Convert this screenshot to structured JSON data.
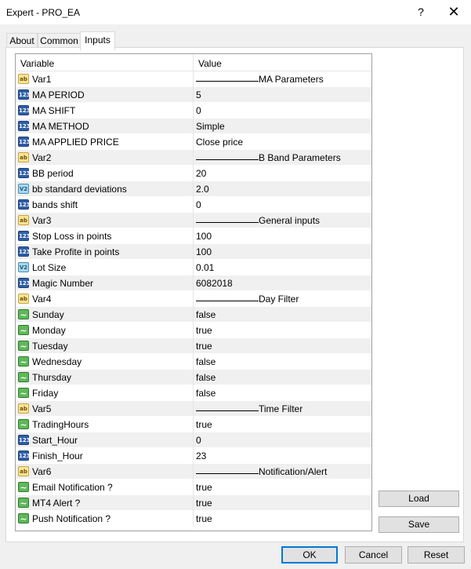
{
  "window": {
    "title": "Expert - PRO_EA",
    "help_glyph": "?",
    "close_glyph": "✕"
  },
  "tabs": [
    {
      "label": "About"
    },
    {
      "label": "Common"
    },
    {
      "label": "Inputs"
    }
  ],
  "table": {
    "headers": {
      "variable": "Variable",
      "value": "Value"
    },
    "rows": [
      {
        "type": "string",
        "icon": "ab",
        "name": "Var1",
        "value": "MA Parameters",
        "separator": true
      },
      {
        "type": "int",
        "icon": "123",
        "name": "MA PERIOD",
        "value": "5"
      },
      {
        "type": "int",
        "icon": "123",
        "name": "MA SHIFT",
        "value": "0"
      },
      {
        "type": "int",
        "icon": "123",
        "name": "MA METHOD",
        "value": "Simple"
      },
      {
        "type": "int",
        "icon": "123",
        "name": "MA APPLIED PRICE",
        "value": "Close price"
      },
      {
        "type": "string",
        "icon": "ab",
        "name": "Var2",
        "value": "B Band Parameters",
        "separator": true
      },
      {
        "type": "int",
        "icon": "123",
        "name": "BB period",
        "value": "20"
      },
      {
        "type": "double",
        "icon": "V2",
        "name": "bb standard deviations",
        "value": "2.0"
      },
      {
        "type": "int",
        "icon": "123",
        "name": "bands shift",
        "value": "0"
      },
      {
        "type": "string",
        "icon": "ab",
        "name": "Var3",
        "value": "General inputs",
        "separator": true
      },
      {
        "type": "int",
        "icon": "123",
        "name": "Stop Loss in points",
        "value": "100"
      },
      {
        "type": "int",
        "icon": "123",
        "name": "Take Profite in points",
        "value": "100"
      },
      {
        "type": "double",
        "icon": "V2",
        "name": "Lot Size",
        "value": "0.01"
      },
      {
        "type": "int",
        "icon": "123",
        "name": "Magic Number",
        "value": "6082018"
      },
      {
        "type": "string",
        "icon": "ab",
        "name": "Var4",
        "value": "Day Filter",
        "separator": true
      },
      {
        "type": "bool",
        "icon": "~",
        "name": "Sunday",
        "value": "false"
      },
      {
        "type": "bool",
        "icon": "~",
        "name": "Monday",
        "value": "true"
      },
      {
        "type": "bool",
        "icon": "~",
        "name": "Tuesday",
        "value": "true"
      },
      {
        "type": "bool",
        "icon": "~",
        "name": "Wednesday",
        "value": "false"
      },
      {
        "type": "bool",
        "icon": "~",
        "name": "Thursday",
        "value": "false"
      },
      {
        "type": "bool",
        "icon": "~",
        "name": "Friday",
        "value": "false"
      },
      {
        "type": "string",
        "icon": "ab",
        "name": "Var5",
        "value": "Time Filter",
        "separator": true
      },
      {
        "type": "bool",
        "icon": "~",
        "name": "TradingHours",
        "value": "true"
      },
      {
        "type": "int",
        "icon": "123",
        "name": "Start_Hour",
        "value": "0"
      },
      {
        "type": "int",
        "icon": "123",
        "name": "Finish_Hour",
        "value": "23"
      },
      {
        "type": "string",
        "icon": "ab",
        "name": "Var6",
        "value": "Notification/Alert",
        "separator": true
      },
      {
        "type": "bool",
        "icon": "~",
        "name": "Email Notification ?",
        "value": "true"
      },
      {
        "type": "bool",
        "icon": "~",
        "name": "MT4 Alert ?",
        "value": "true"
      },
      {
        "type": "bool",
        "icon": "~",
        "name": "Push Notification ?",
        "value": "true"
      }
    ]
  },
  "side_buttons": {
    "load": "Load",
    "save": "Save"
  },
  "footer_buttons": {
    "ok": "OK",
    "cancel": "Cancel",
    "reset": "Reset"
  },
  "colors": {
    "default_button_border": "#0078d7",
    "shaded_row": "#f0f0f0"
  }
}
